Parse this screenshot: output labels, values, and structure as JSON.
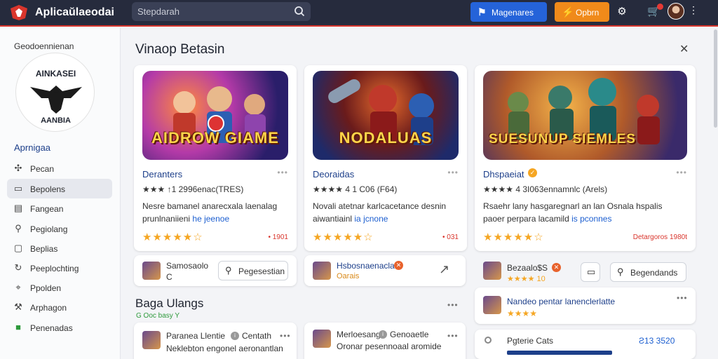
{
  "topbar": {
    "app_title": "Aplicaŭlaeodai",
    "search_placeholder": "Stepdarah",
    "blue_button": "Magenares",
    "orange_button": "Opbrn",
    "brand_color": "#262b3d",
    "accent_color": "#d9352c"
  },
  "sidebar": {
    "header": "Geodoennienan",
    "logo_top": "AINKASEI",
    "logo_bottom": "AANBIA",
    "section": "Aprnigaa",
    "items": [
      {
        "label": "Pecan",
        "icon": "puzzle-icon"
      },
      {
        "label": "Bepolens",
        "icon": "square-icon"
      },
      {
        "label": "Fangean",
        "icon": "grid-icon"
      },
      {
        "label": "Pegiolang",
        "icon": "search-icon"
      },
      {
        "label": "Beplias",
        "icon": "box-icon"
      },
      {
        "label": "Peeplochting",
        "icon": "refresh-icon"
      },
      {
        "label": "Ppolden",
        "icon": "tag-icon"
      },
      {
        "label": "Arphagon",
        "icon": "wrench-icon"
      },
      {
        "label": "Penenadas",
        "icon": "green-square-icon"
      }
    ]
  },
  "main": {
    "title": "Vinaop Betasin",
    "cards": [
      {
        "game_title": "AIDROW GIAME",
        "name": "Deranters",
        "dots": "•••",
        "meta": "★★★ ↑1 2996enac(TRES)",
        "desc1": "Nesre bamanel anarecxala laenalag",
        "desc2a": "prunlnaniieni",
        "desc2b": "he jeenoe",
        "rating": "★★★★★☆",
        "count": "• 1901"
      },
      {
        "game_title": "NODALUAS",
        "name": "Deoraidas",
        "dots": "•••",
        "meta": "★★★★ 4 1 C06 (F64)",
        "desc1": "Novali atetnar karlcacetance desnin",
        "desc2a": "aiwantiainl",
        "desc2b": "ia jcnone",
        "rating": "★★★★★☆",
        "count": "• 031"
      },
      {
        "game_title": "SUESUNUP SIEMLES",
        "name": "Dhspaeiat",
        "dots": "•••",
        "meta": "★★★★ 4 3I063ennamnlc (Arels)",
        "desc1": "Rsaehr lany hasgaregnarl an lan Osnala hspalis",
        "desc2a": "paoer perpara lacamild",
        "desc2b": "is pconnes",
        "rating": "★★★★★☆",
        "count": "Detargoros 1980t"
      }
    ],
    "subrows": [
      {
        "title": "Samosaolo",
        "sub": "C",
        "pill": "Pegesestian"
      },
      {
        "title": "Hsbosnaenaclao",
        "sub": "Oarais",
        "pill": ""
      },
      {
        "title": "Bezaalo$S",
        "sub": "★★★★ 10",
        "pill": "Begendands"
      }
    ],
    "section2_title": "Baga Ulangs",
    "section2_sub": "G Ooc basy Y",
    "right_list": {
      "item1": "Nandeo pentar lanenclerlatte",
      "item1_rating": "★★★★",
      "item2": "Pgterie Cats",
      "item2_value": "Ƨ13 3520"
    },
    "bottom_cards": [
      {
        "title": "Paranea Llentie",
        "tag": "Centath",
        "line": "Neklebton engonel aeronantlan"
      },
      {
        "title": "Merloesang",
        "tag": "Genoaetle",
        "line": "Oronar pesennoaal aromide"
      }
    ]
  }
}
